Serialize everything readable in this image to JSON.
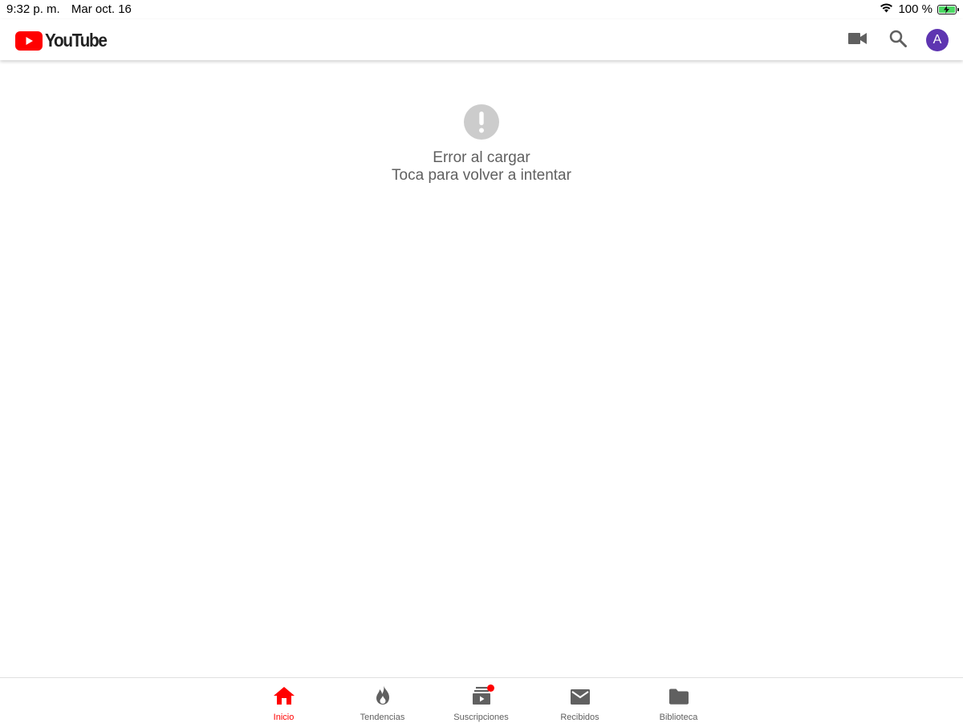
{
  "status_bar": {
    "time": "9:32 p. m.",
    "date": "Mar oct. 16",
    "battery": "100 %",
    "battery_level": 1.0
  },
  "app_bar": {
    "logo_text": "YouTube",
    "avatar_letter": "A",
    "icons": [
      "video-camera-icon",
      "search-icon"
    ]
  },
  "error": {
    "title": "Error al cargar",
    "subtitle": "Toca para volver a intentar",
    "icon": "exclamation-icon"
  },
  "bottom_nav": {
    "items": [
      {
        "label": "Inicio",
        "icon": "home-icon",
        "active": true
      },
      {
        "label": "Tendencias",
        "icon": "flame-icon",
        "active": false
      },
      {
        "label": "Suscripciones",
        "icon": "subscriptions-icon",
        "active": false
      },
      {
        "label": "Recibidos",
        "icon": "mail-icon",
        "active": false
      },
      {
        "label": "Biblioteca",
        "icon": "folder-icon",
        "active": false
      }
    ]
  },
  "colors": {
    "brand_red": "#ff0000",
    "icon_grey": "#606060",
    "error_icon_grey": "#cccccc",
    "avatar_purple": "#5e35b1",
    "battery_green": "#4cd964"
  }
}
